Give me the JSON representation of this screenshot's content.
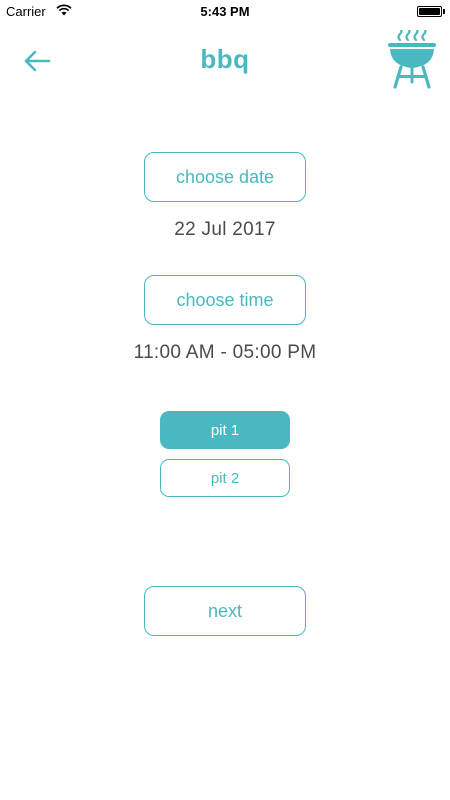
{
  "status_bar": {
    "carrier": "Carrier",
    "time": "5:43 PM",
    "battery_level": 1.0
  },
  "nav": {
    "title": "bbq",
    "back_icon": "arrow-left-icon",
    "grill_icon": "bbq-grill-icon"
  },
  "main": {
    "choose_date_label": "choose date",
    "selected_date": "22 Jul 2017",
    "choose_time_label": "choose time",
    "selected_time": "11:00 AM - 05:00 PM",
    "pits": [
      {
        "label": "pit 1",
        "selected": true
      },
      {
        "label": "pit 2",
        "selected": false
      }
    ],
    "next_label": "next"
  },
  "colors": {
    "accent": "#4ab8c1",
    "text": "#4a4a4a",
    "background": "#ffffff"
  }
}
